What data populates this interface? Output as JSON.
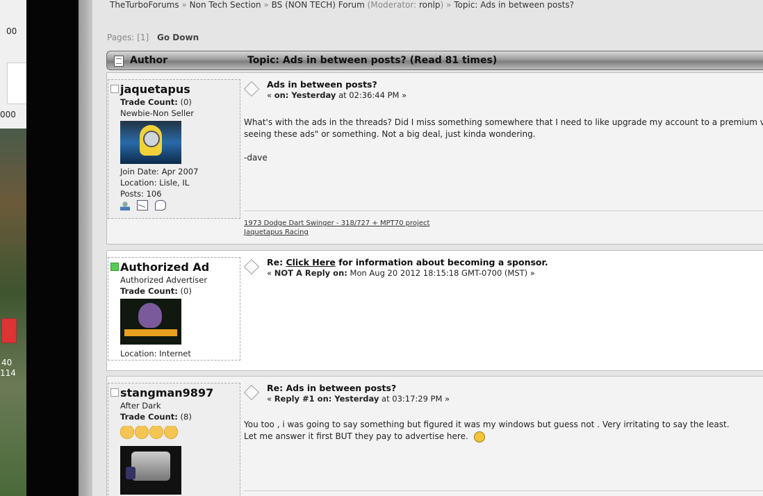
{
  "desktop": {
    "fragments": [
      "00",
      "000",
      "40",
      "114"
    ]
  },
  "breadcrumb": {
    "items": [
      "TheTurboForums",
      "Non Tech Section",
      "BS (NON TECH) Forum"
    ],
    "separator": "»",
    "moderator_prefix": "(Moderator: ",
    "moderator": "ronlp",
    "moderator_suffix": ")",
    "topic": "Topic: Ads in between posts?"
  },
  "pages": {
    "label": "Pages: [1]",
    "go_down": "Go Down"
  },
  "topic_header": {
    "author": "Author",
    "topic": "Topic: Ads in between posts?  (Read 81 times)"
  },
  "posts": [
    {
      "author": "jaquetapus",
      "lines": [
        [
          "Trade Count:",
          " (0)"
        ],
        [
          "",
          "Newbie-Non Seller"
        ]
      ],
      "details": [
        "Join Date: Apr 2007",
        "Location: Lisle, IL",
        "Posts: 106"
      ],
      "subject": "Ads in between posts?",
      "meta_prefix": "« ",
      "meta_bold": "on: Yesterday",
      "meta_rest": " at 02:36:44 PM »",
      "body": [
        "What's with the ads in the threads? Did I miss something somewhere that I need to like upgrade my account to a premium v",
        "seeing these ads\" or something. Not a big deal, just kinda wondering.",
        "",
        "-dave"
      ],
      "signature": [
        "1973 Dodge Dart Swinger - 318/727 + MPT70 project",
        "Jaquetapus Racing"
      ]
    },
    {
      "author": "Authorized Ad",
      "lines": [
        [
          "",
          "Authorized Advertiser"
        ],
        [
          "Trade Count:",
          " (0)"
        ]
      ],
      "details": [
        "Location: Internet"
      ],
      "subject_prefix": "Re: ",
      "subject_link": "Click Here",
      "subject_rest": " for information about becoming a sponsor.",
      "meta_prefix": "« ",
      "meta_bold": "NOT A Reply on:",
      "meta_rest": " Mon Aug 20 2012 18:15:18 GMT-0700 (MST) »"
    },
    {
      "author": "stangman9897",
      "lines": [
        [
          "",
          "After Dark"
        ],
        [
          "Trade Count:",
          " (8)"
        ]
      ],
      "subject": "Re: Ads in between posts?",
      "meta_prefix": "« ",
      "meta_bold": "Reply #1 on: Yesterday",
      "meta_rest": " at 03:17:29 PM »",
      "body": [
        "You too , i was going to say something but figured it was my windows but guess not . Very irritating to say the least.",
        "Let me answer it first BUT they pay to advertise here."
      ]
    }
  ],
  "colors": {
    "page_bg": "#e5e5e5",
    "ad_bg": "#ffffff",
    "online_status": "#55cc55"
  }
}
